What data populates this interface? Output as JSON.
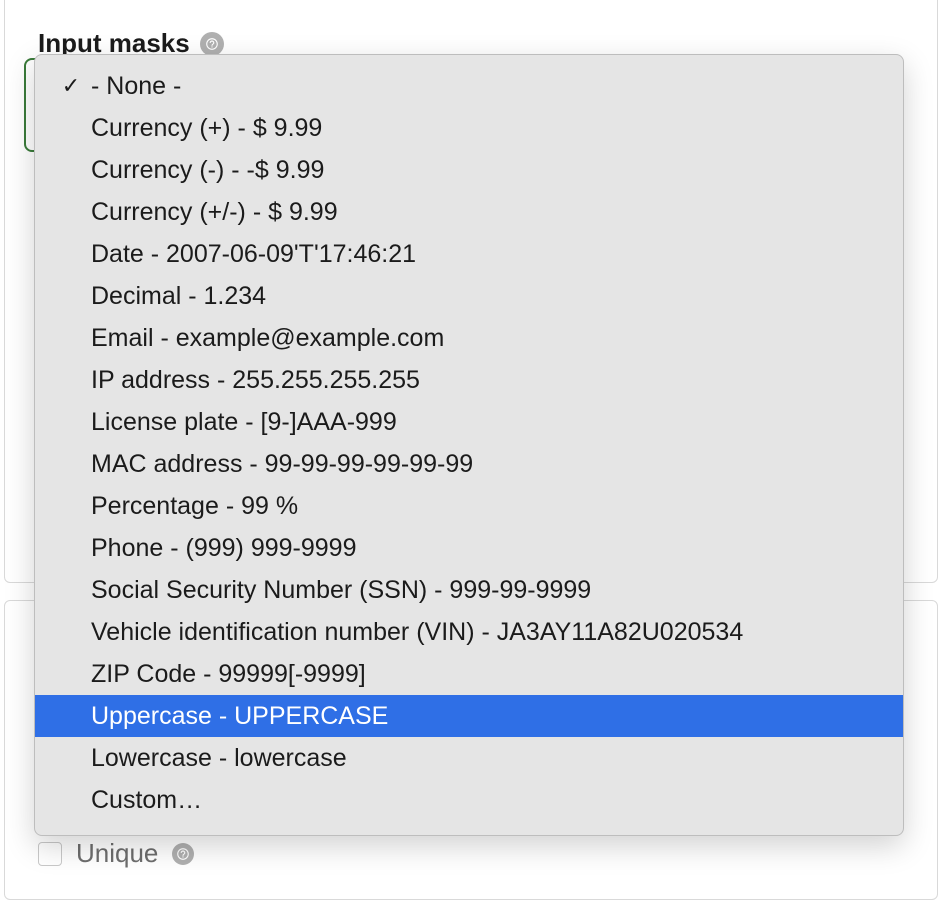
{
  "field": {
    "label": "Input masks"
  },
  "dropdown": {
    "selectedIndex": 0,
    "highlightedIndex": 15,
    "options": [
      "- None -",
      "Currency (+) - $ 9.99",
      "Currency (-) - -$ 9.99",
      "Currency (+/-) - $ 9.99",
      "Date - 2007-06-09'T'17:46:21",
      "Decimal - 1.234",
      "Email - example@example.com",
      "IP address - 255.255.255.255",
      "License plate - [9-]AAA-999",
      "MAC address - 99-99-99-99-99-99",
      "Percentage - 99 %",
      "Phone - (999) 999-9999",
      "Social Security Number (SSN) - 999-99-9999",
      "Vehicle identification number (VIN) - JA3AY11A82U020534",
      "ZIP Code - 99999[-9999]",
      "Uppercase - UPPERCASE",
      "Lowercase - lowercase",
      "Custom…"
    ]
  },
  "bg": {
    "uniqueLabel": "Unique"
  }
}
